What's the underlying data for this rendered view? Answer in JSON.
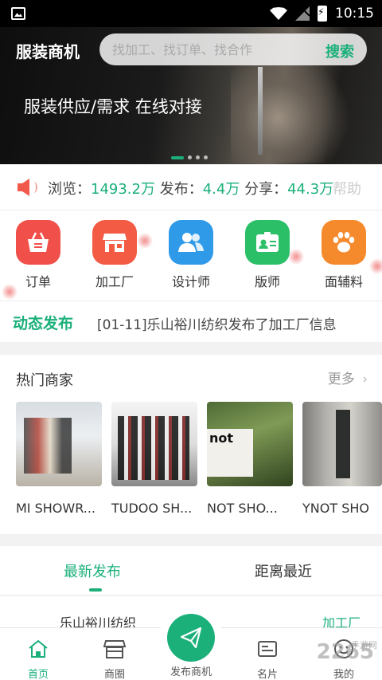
{
  "status_bar": {
    "time": "10:15"
  },
  "header": {
    "app_title": "服装商机",
    "search_placeholder": "找加工、找订单、找合作",
    "search_button": "搜索"
  },
  "banner": {
    "slogan": "服装供应/需求 在线对接"
  },
  "stats": {
    "views_label": "浏览：",
    "views_value": "1493.2万",
    "posts_label": "发布：",
    "posts_value": "4.4万",
    "shares_label": "分享：",
    "shares_value": "44.3万",
    "help_label": "帮助"
  },
  "categories": [
    {
      "label": "订单",
      "icon": "basket-icon",
      "color": "#f1504a"
    },
    {
      "label": "加工厂",
      "icon": "storefront-icon",
      "color": "#f45b44"
    },
    {
      "label": "设计师",
      "icon": "people-icon",
      "color": "#2f9ae8"
    },
    {
      "label": "版师",
      "icon": "id-card-icon",
      "color": "#2bbf68"
    },
    {
      "label": "面辅料",
      "icon": "paw-icon",
      "color": "#f58a2d"
    }
  ],
  "news": {
    "label": "动态发布",
    "text": "[01-11]乐山裕川纺织发布了加工厂信息"
  },
  "hot_merchants": {
    "title": "热门商家",
    "more": "更多",
    "items": [
      {
        "name": "MI SHOWR..."
      },
      {
        "name": "TUDOO SH..."
      },
      {
        "name": "NOT SHO..."
      },
      {
        "name": "YNOT SHO"
      }
    ]
  },
  "tabs": {
    "latest": "最新发布",
    "nearest": "距离最近"
  },
  "list": {
    "first_name": "乐山裕川纺织",
    "first_tag": "加工厂"
  },
  "bottom_nav": {
    "home": "首页",
    "circle": "商圈",
    "publish": "发布商机",
    "card": "名片",
    "mine": "我的"
  },
  "watermark": {
    "big": "2265",
    "small": "手游网"
  },
  "colors": {
    "accent": "#1bb07a"
  }
}
